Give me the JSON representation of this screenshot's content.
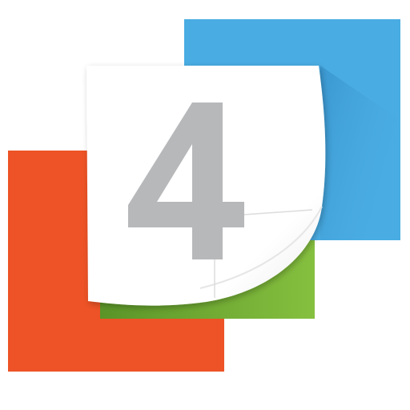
{
  "logo": {
    "numeral": "4",
    "colors": {
      "orange": "#ed5326",
      "blue": "#49ace2",
      "blue_shadow": "#2f86c2",
      "green": "#7cb93b",
      "green_dark": "#5a9428",
      "page": "#ffffff",
      "numeral": "#b7b8ba"
    }
  }
}
